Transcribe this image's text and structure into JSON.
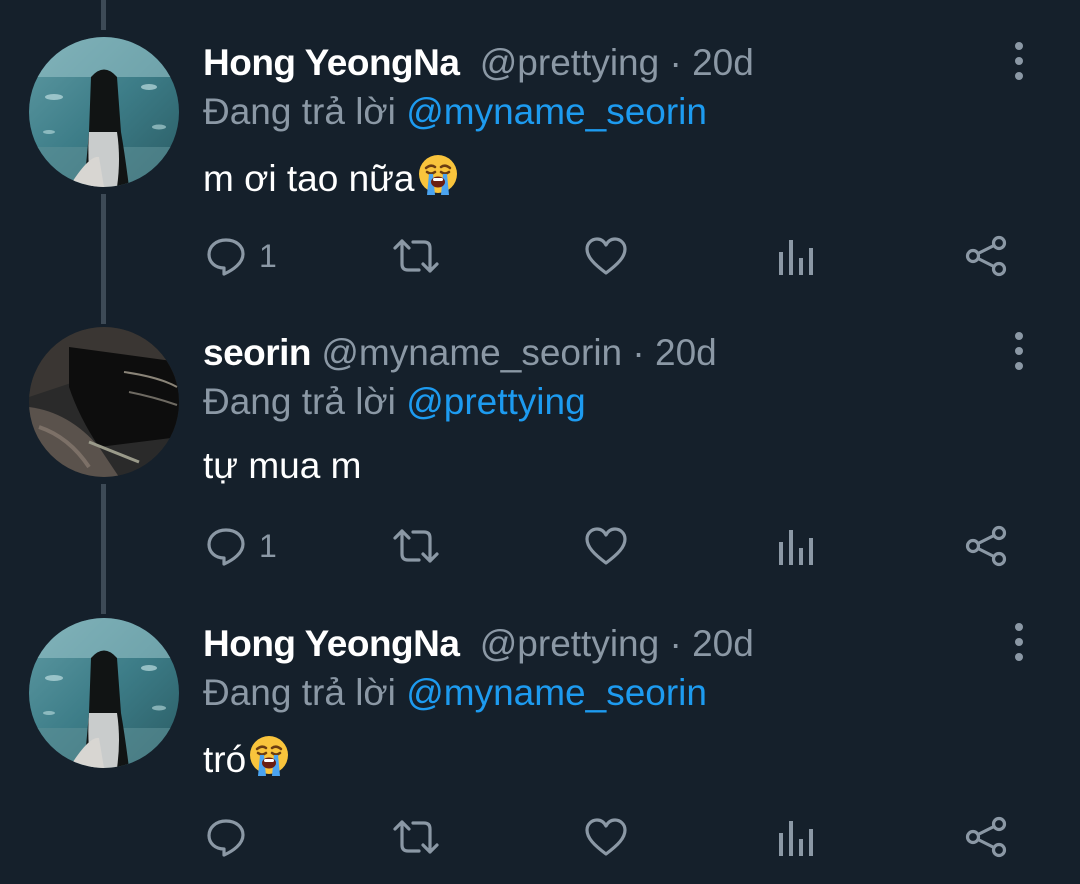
{
  "tweets": [
    {
      "name": "Hong YeongNa",
      "handle": "@prettying",
      "separator": "·",
      "time": "20d",
      "reply_prefix": "Đang trả lời",
      "reply_to": "@myname_seorin",
      "text": "m ơi tao nữa",
      "emoji": "loudly-crying-face",
      "reply_count": "1",
      "avatar": "aquarium-photo"
    },
    {
      "name": "seorin",
      "handle": "@myname_seorin",
      "separator": "·",
      "time": "20d",
      "reply_prefix": "Đang trả lời",
      "reply_to": "@prettying",
      "text": "tự mua m",
      "emoji": "",
      "reply_count": "1",
      "avatar": "dark-clothing-photo"
    },
    {
      "name": "Hong YeongNa",
      "handle": "@prettying",
      "separator": "·",
      "time": "20d",
      "reply_prefix": "Đang trả lời",
      "reply_to": "@myname_seorin",
      "text": "tró",
      "emoji": "loudly-crying-face",
      "reply_count": "",
      "avatar": "aquarium-photo"
    }
  ],
  "icons": {
    "reply": "reply-icon",
    "retweet": "retweet-icon",
    "like": "like-icon",
    "analytics": "analytics-icon",
    "share": "share-icon",
    "more": "more-icon"
  },
  "colors": {
    "background": "#15202b",
    "primary_text": "#ffffff",
    "secondary_text": "#8b98a5",
    "mention": "#1d9bf0",
    "thread_line": "#3d4a56"
  }
}
